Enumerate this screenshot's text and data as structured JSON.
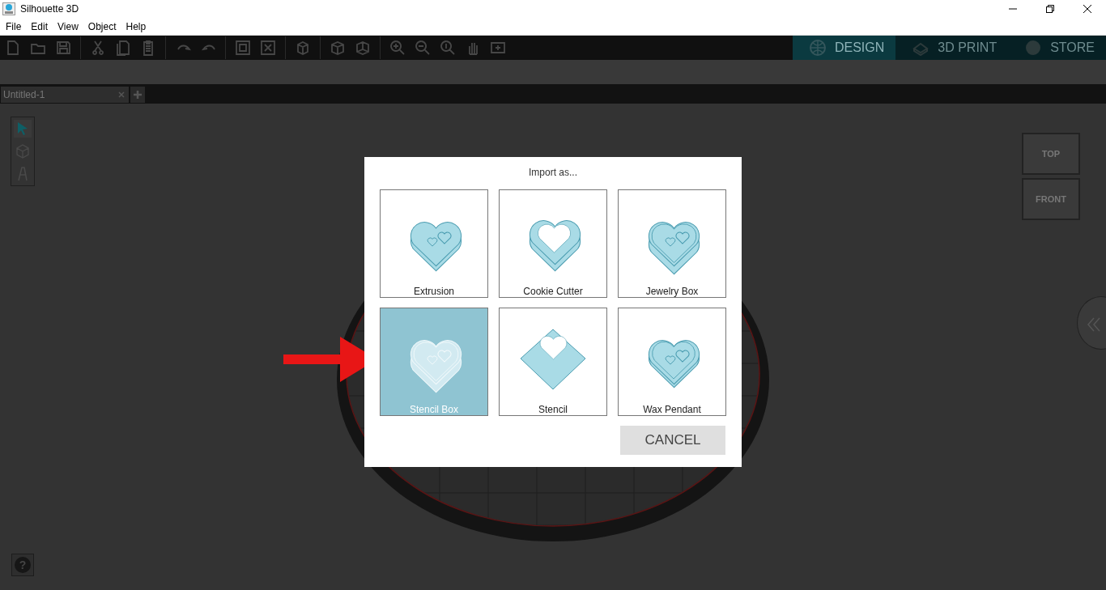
{
  "window": {
    "title": "Silhouette 3D"
  },
  "menu": [
    "File",
    "Edit",
    "View",
    "Object",
    "Help"
  ],
  "modes": [
    {
      "label": "DESIGN",
      "kind": "globe",
      "selected": true
    },
    {
      "label": "3D PRINT",
      "kind": "print",
      "selected": false
    },
    {
      "label": "STORE",
      "kind": "store",
      "selected": false
    }
  ],
  "tabs": [
    {
      "label": "Untitled-1",
      "selected": true
    }
  ],
  "tools": [
    {
      "kind": "pointer",
      "selected": true
    },
    {
      "kind": "cube",
      "selected": false
    },
    {
      "kind": "letter",
      "selected": false
    }
  ],
  "view_cube": {
    "top": "TOP",
    "front": "FRONT"
  },
  "help": "?",
  "dialog": {
    "title": "Import as...",
    "options": [
      {
        "label": "Extrusion",
        "kind": "extrusion",
        "selected": false
      },
      {
        "label": "Cookie Cutter",
        "kind": "cutter",
        "selected": false
      },
      {
        "label": "Jewelry Box",
        "kind": "box",
        "selected": false
      },
      {
        "label": "Stencil Box",
        "kind": "box",
        "selected": true
      },
      {
        "label": "Stencil",
        "kind": "stencil",
        "selected": false
      },
      {
        "label": "Wax Pendant",
        "kind": "pendant",
        "selected": false
      }
    ],
    "cancel": "CANCEL"
  }
}
